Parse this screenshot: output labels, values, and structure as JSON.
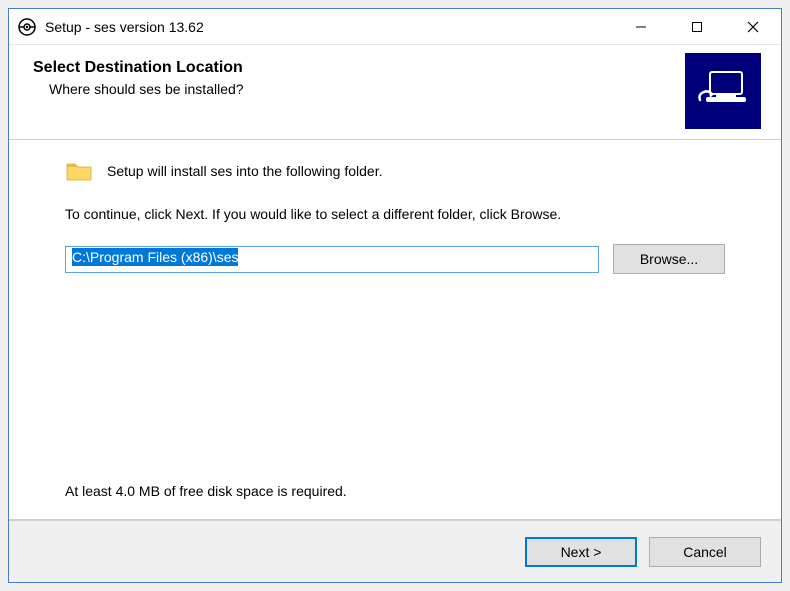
{
  "titlebar": {
    "title": "Setup - ses version 13.62"
  },
  "header": {
    "title": "Select Destination Location",
    "subtitle": "Where should ses be installed?"
  },
  "content": {
    "folder_message": "Setup will install ses into the following folder.",
    "continue_message": "To continue, click Next. If you would like to select a different folder, click Browse.",
    "install_path": "C:\\Program Files (x86)\\ses",
    "browse_label": "Browse...",
    "disk_space": "At least 4.0 MB of free disk space is required."
  },
  "footer": {
    "next_label": "Next >",
    "cancel_label": "Cancel"
  }
}
